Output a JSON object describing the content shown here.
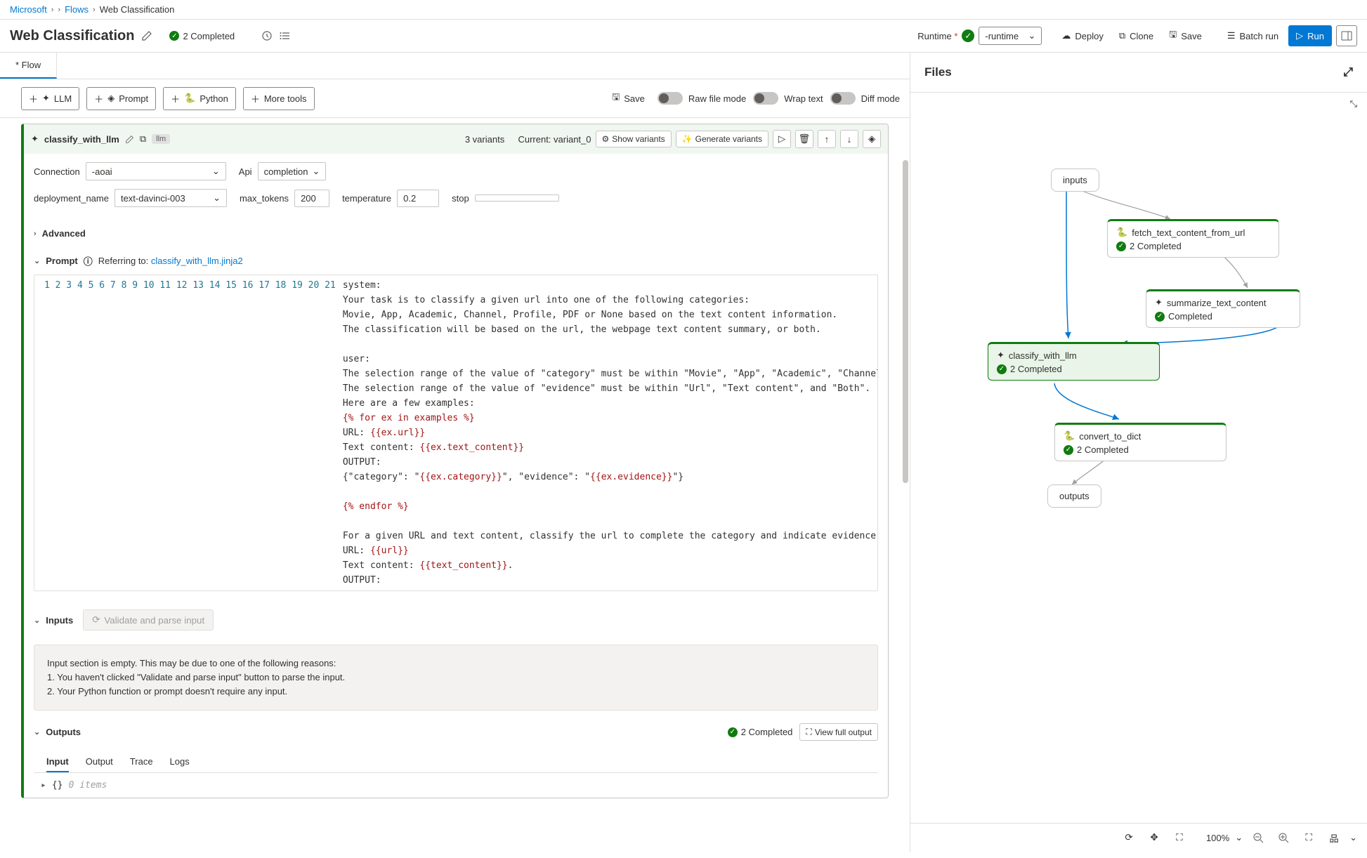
{
  "breadcrumb": {
    "root": "Microsoft",
    "flows": "Flows",
    "current": "Web Classification"
  },
  "page_title": "Web Classification",
  "status": "2 Completed",
  "tab_name": "* Flow",
  "runtime_label": "Runtime",
  "runtime_value": "-runtime",
  "actions": {
    "deploy": "Deploy",
    "clone": "Clone",
    "save": "Save",
    "batch": "Batch run",
    "run": "Run"
  },
  "toolbar_btns": {
    "llm": "LLM",
    "prompt": "Prompt",
    "python": "Python",
    "more": "More tools",
    "save": "Save"
  },
  "toggles": {
    "raw": "Raw file mode",
    "wrap": "Wrap text",
    "diff": "Diff mode"
  },
  "node": {
    "name": "classify_with_llm",
    "type": "llm",
    "variants": "3 variants",
    "current": "Current: variant_0",
    "show_variants": "Show variants",
    "gen_variants": "Generate variants"
  },
  "params": {
    "connection_label": "Connection",
    "connection_value": "-aoai",
    "api_label": "Api",
    "api_value": "completion",
    "deployment_label": "deployment_name",
    "deployment_value": "text-davinci-003",
    "max_tokens_label": "max_tokens",
    "max_tokens_value": "200",
    "temperature_label": "temperature",
    "temperature_value": "0.2",
    "stop_label": "stop",
    "stop_value": ""
  },
  "advanced": "Advanced",
  "prompt": {
    "label": "Prompt",
    "referring": "Referring to:",
    "file": "classify_with_llm.jinja2"
  },
  "code_lines": [
    "system:",
    "Your task is to classify a given url into one of the following categories:",
    "Movie, App, Academic, Channel, Profile, PDF or None based on the text content information.",
    "The classification will be based on the url, the webpage text content summary, or both.",
    "",
    "user:",
    "The selection range of the value of \"category\" must be within \"Movie\", \"App\", \"Academic\", \"Channel\", \"Profile\", \"PDF\" and \"None\".",
    "The selection range of the value of \"evidence\" must be within \"Url\", \"Text content\", and \"Both\".",
    "Here are a few examples:",
    "{% for ex in examples %}",
    "URL: {{ex.url}}",
    "Text content: {{ex.text_content}}",
    "OUTPUT:",
    "{\"category\": \"{{ex.category}}\", \"evidence\": \"{{ex.evidence}}\"}",
    "",
    "{% endfor %}",
    "",
    "For a given URL and text content, classify the url to complete the category and indicate evidence:",
    "URL: {{url}}",
    "Text content: {{text_content}}.",
    "OUTPUT:"
  ],
  "inputs": {
    "label": "Inputs",
    "validate": "Validate and parse input",
    "empty_msg": "Input section is empty. This may be due to one of the following reasons:",
    "reason1": "1. You haven't clicked \"Validate and parse input\" button to parse the input.",
    "reason2": "2. Your Python function or prompt doesn't require any input."
  },
  "outputs": {
    "label": "Outputs",
    "status": "2 Completed",
    "view_full": "View full output",
    "tabs": {
      "input": "Input",
      "output": "Output",
      "trace": "Trace",
      "logs": "Logs"
    },
    "json_preview": "0 items"
  },
  "files_panel": {
    "title": "Files"
  },
  "graph": {
    "inputs": "inputs",
    "outputs": "outputs",
    "n1": {
      "name": "fetch_text_content_from_url",
      "status": "2 Completed"
    },
    "n2": {
      "name": "summarize_text_content",
      "status": "Completed"
    },
    "n3": {
      "name": "classify_with_llm",
      "status": "2 Completed"
    },
    "n4": {
      "name": "convert_to_dict",
      "status": "2 Completed"
    }
  },
  "zoom": "100%"
}
